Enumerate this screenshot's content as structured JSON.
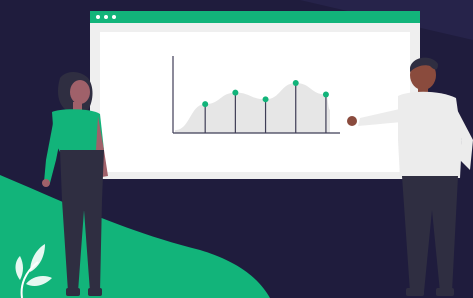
{
  "scene": {
    "description_colors": {
      "background": "#1f1c3d",
      "accent": "#12b47a",
      "window_frame": "#efefef",
      "window_content": "#ffffff",
      "chart_area": "#e6e6e6",
      "chart_line": "#3f3d56",
      "skin_dark": "#8a4b3d",
      "hair_dark": "#2f2e41",
      "shirt_light": "#ececec",
      "pants_dark": "#2f2e41"
    },
    "icons": [
      "browser-window-illustration",
      "presenter-woman-illustration",
      "presenter-man-illustration",
      "leaf-icon"
    ]
  },
  "chart_data": {
    "type": "area",
    "title": "",
    "xlabel": "",
    "ylabel": "",
    "x": [
      1,
      2,
      3,
      4,
      5
    ],
    "values": [
      30,
      42,
      35,
      52,
      40
    ],
    "ylim": [
      0,
      80
    ],
    "grid": false,
    "marker_color": "#12b47a"
  }
}
